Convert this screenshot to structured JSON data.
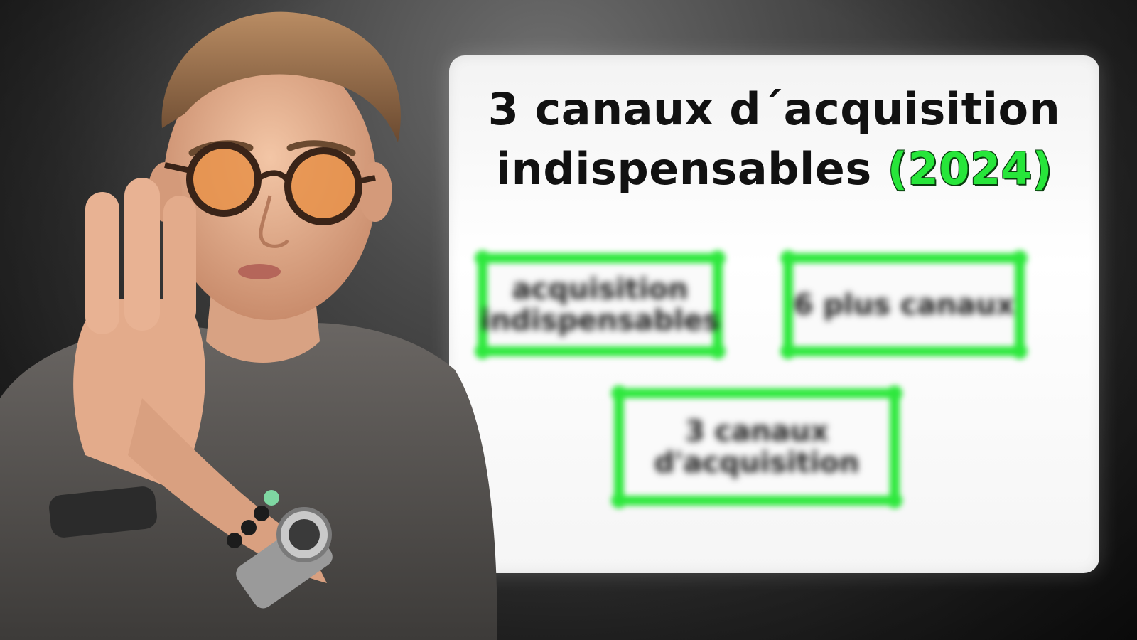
{
  "board": {
    "title_line1": "3 canaux d´acquisition",
    "title_line2_prefix": "indispensables ",
    "title_year": "(2024)",
    "boxes": [
      {
        "text": "acquisition indispensables"
      },
      {
        "text": "6 plus canaux"
      },
      {
        "text": "3 canaux d'acquisition"
      }
    ]
  },
  "colors": {
    "accent_green": "#2ee83d",
    "board_white": "#ffffff",
    "background_dark": "#1e1e1e",
    "lens_orange": "#e8924a",
    "shirt_gray": "#5b5855"
  }
}
